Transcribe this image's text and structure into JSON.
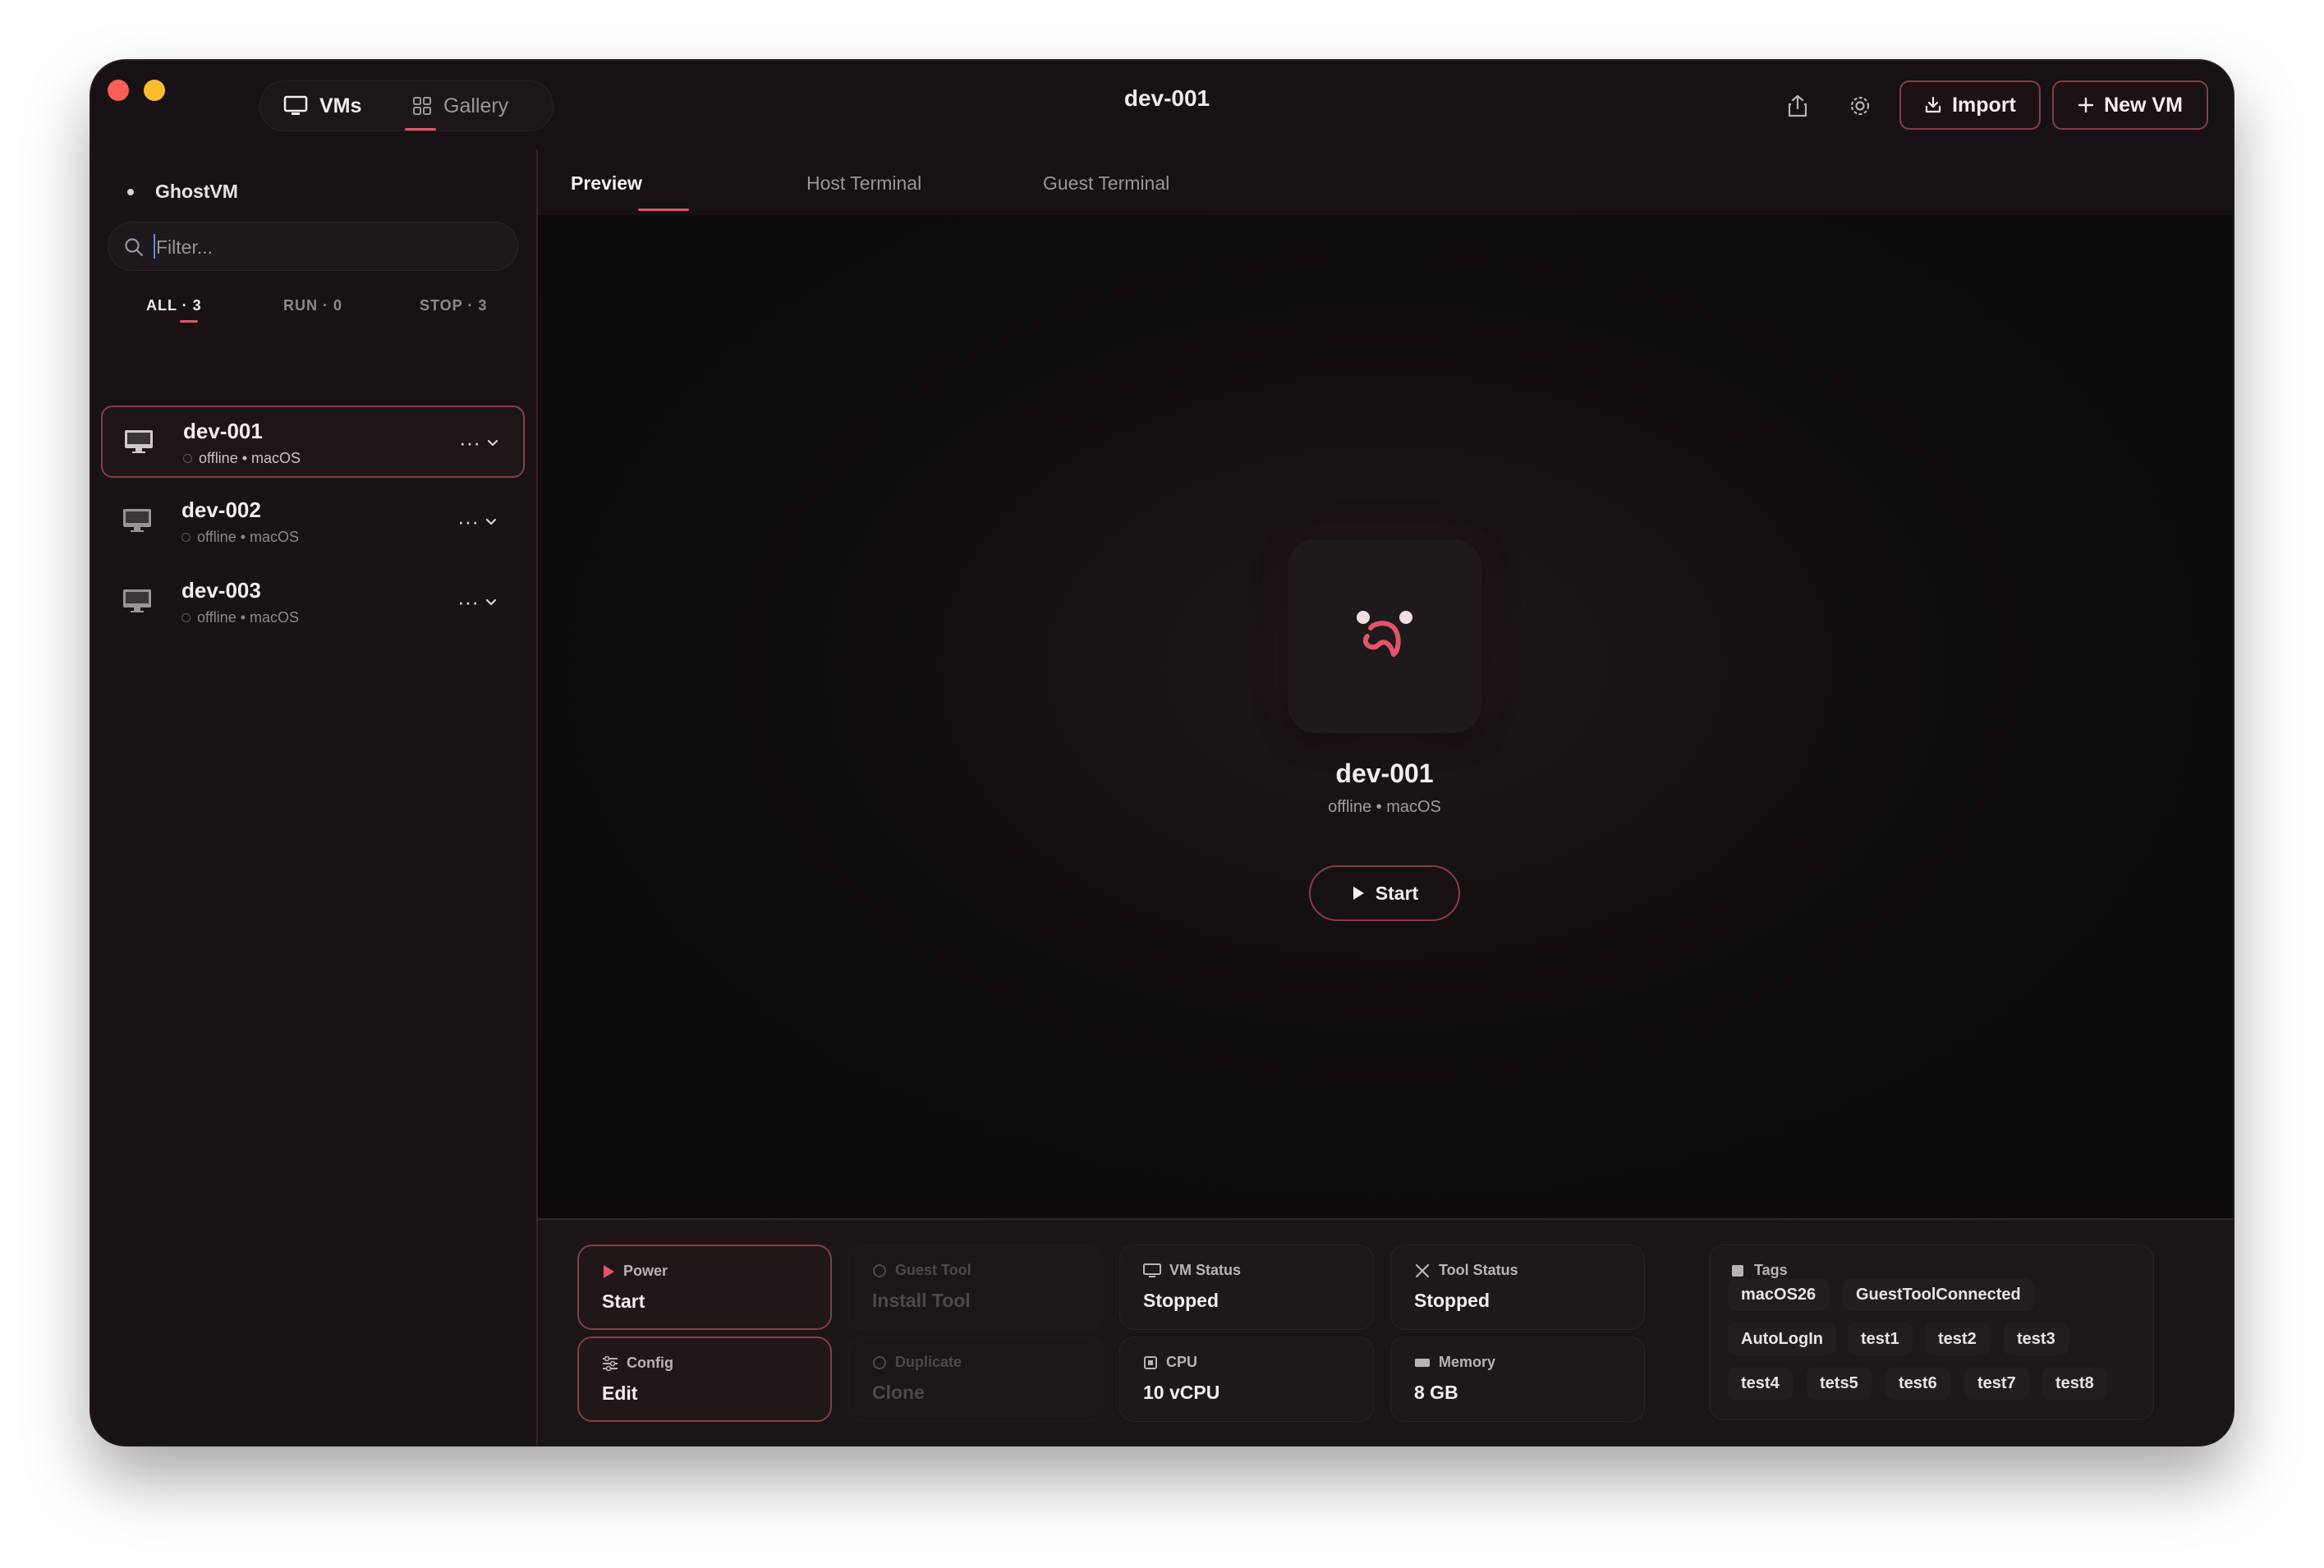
{
  "window": {
    "title": "dev-001"
  },
  "nav": {
    "vms_label": "VMs",
    "gallery_label": "Gallery"
  },
  "toolbar": {
    "import_label": "Import",
    "new_vm_label": "New VM"
  },
  "sidebar": {
    "brand": "GhostVM",
    "filter_placeholder": "Filter...",
    "filter_tabs": {
      "all": "ALL · 3",
      "run": "RUN · 0",
      "stop": "STOP · 3"
    },
    "vms": [
      {
        "name": "dev-001",
        "status": "offline • macOS",
        "more": "···"
      },
      {
        "name": "dev-002",
        "status": "offline • macOS",
        "more": "···"
      },
      {
        "name": "dev-003",
        "status": "offline • macOS",
        "more": "···"
      }
    ]
  },
  "main": {
    "tabs": {
      "preview": "Preview",
      "host_terminal": "Host Terminal",
      "guest_terminal": "Guest Terminal"
    },
    "preview": {
      "name": "dev-001",
      "status": "offline • macOS",
      "start_label": "Start"
    }
  },
  "details": {
    "power": {
      "label": "Power",
      "value": "Start"
    },
    "guest_tool": {
      "label": "Guest Tool",
      "value": "Install Tool"
    },
    "vm_status": {
      "label": "VM Status",
      "value": "Stopped"
    },
    "tool_status": {
      "label": "Tool Status",
      "value": "Stopped"
    },
    "config": {
      "label": "Config",
      "value": "Edit"
    },
    "duplicate": {
      "label": "Duplicate",
      "value": "Clone"
    },
    "cpu": {
      "label": "CPU",
      "value": "10 vCPU"
    },
    "memory": {
      "label": "Memory",
      "value": "8 GB"
    },
    "tags_label": "Tags",
    "tags": [
      "macOS26",
      "GuestToolConnected",
      "AutoLogIn",
      "test1",
      "test2",
      "test3",
      "test4",
      "tets5",
      "test6",
      "test7",
      "test8"
    ]
  },
  "colors": {
    "accent": "#e0556a",
    "accent_border": "#8a3b47",
    "background": "#141013"
  }
}
